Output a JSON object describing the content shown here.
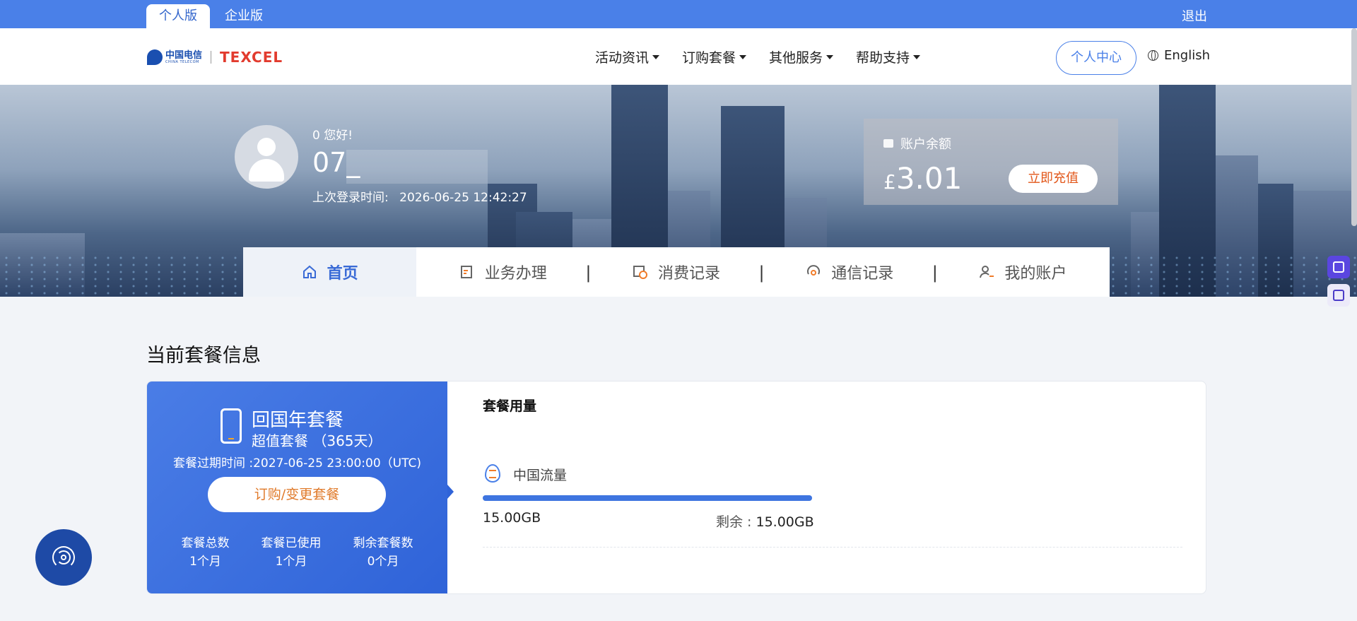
{
  "topbar": {
    "tabs": [
      {
        "label": "个人版"
      },
      {
        "label": "企业版"
      }
    ],
    "logout": "退出"
  },
  "header": {
    "logo": {
      "ct_text": "中国电信",
      "ct_sub": "CHINA TELECOM",
      "texcel": "TEXCEL"
    },
    "nav": [
      {
        "label": "活动资讯"
      },
      {
        "label": "订购套餐"
      },
      {
        "label": "其他服务"
      },
      {
        "label": "帮助支持"
      }
    ],
    "personal_center": "个人中心",
    "language": "English"
  },
  "profile": {
    "greeting": "0 您好!",
    "username": "07_",
    "last_login_label": "上次登录时间:",
    "last_login": "2026-06-25 12:42:27"
  },
  "balance": {
    "label": "账户余额",
    "currency": "£",
    "amount": "3.01",
    "recharge": "立即充值"
  },
  "tabs": [
    {
      "label": "首页",
      "icon": "home-icon"
    },
    {
      "label": "业务办理",
      "icon": "edit-icon"
    },
    {
      "label": "消费记录",
      "icon": "clock-icon"
    },
    {
      "label": "通信记录",
      "icon": "signal-icon"
    },
    {
      "label": "我的账户",
      "icon": "user-icon"
    }
  ],
  "content": {
    "section_title": "当前套餐信息",
    "package": {
      "name": "回国年套餐",
      "subtitle": "超值套餐 （365天）",
      "expire": "套餐过期时间 :2027-06-25 23:00:00（UTC)",
      "order_button": "订购/变更套餐",
      "stats": [
        {
          "label": "套餐总数",
          "value": "1个月"
        },
        {
          "label": "套餐已使用",
          "value": "1个月"
        },
        {
          "label": "剩余套餐数",
          "value": "0个月"
        }
      ]
    },
    "usage": {
      "title": "套餐用量",
      "item_label": "中国流量",
      "used": "15.00GB",
      "remain_label": "剩余 :",
      "remain": "15.00GB",
      "progress_percent": 100
    }
  },
  "colors": {
    "brand_blue": "#4a80e8",
    "card_blue": "#2f63d8",
    "accent_orange": "#e07a2a",
    "recharge_red": "#e2571a"
  }
}
